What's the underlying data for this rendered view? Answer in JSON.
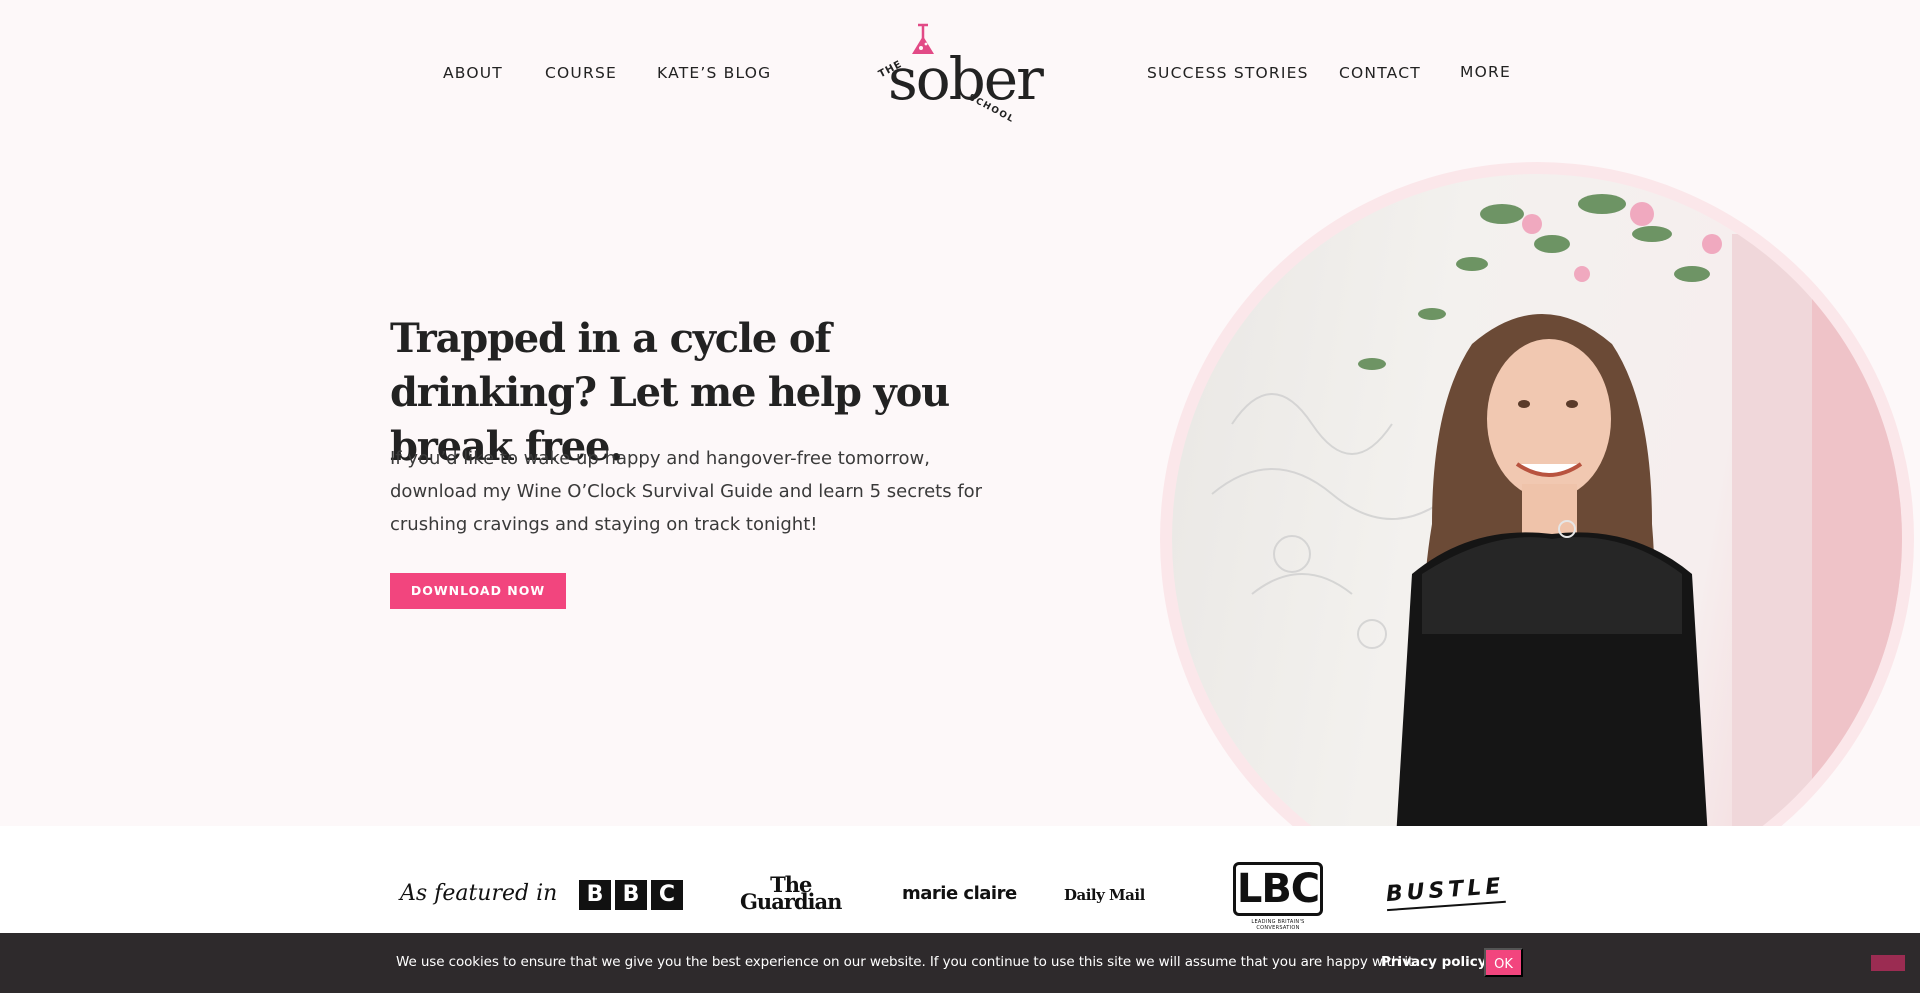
{
  "nav": {
    "left": [
      {
        "label": "ABOUT"
      },
      {
        "label": "COURSE"
      },
      {
        "label": "KATE’S BLOG"
      }
    ],
    "right": [
      {
        "label": "SUCCESS STORIES"
      },
      {
        "label": "CONTACT"
      },
      {
        "label": "MORE"
      }
    ]
  },
  "logo": {
    "the": "THE",
    "sober": "sober",
    "school": "SCHOOL"
  },
  "hero": {
    "title": "Trapped in a cycle of drinking? Let me help you break free.",
    "body": "If you’d like to wake up happy and hangover-free tomorrow, download my Wine O’Clock Survival Guide and learn 5 secrets for crushing cravings and staying on track tonight!",
    "cta_label": "DOWNLOAD NOW"
  },
  "featured": {
    "label": "As featured in",
    "logos": {
      "bbc": [
        "B",
        "B",
        "C"
      ],
      "guardian_line1": "The",
      "guardian_line2": "Guardian",
      "marie_claire": "marie claire",
      "daily_mail": "Daily Mail",
      "lbc": "LBC",
      "lbc_tagline": "LEADING BRITAIN'S CONVERSATION",
      "bustle": "BUSTLE"
    }
  },
  "cookie": {
    "text": "We use cookies to ensure that we give you the best experience on our website. If you continue to use this site we will assume that you are happy with it.",
    "privacy_label": "Privacy policy",
    "ok_label": "OK"
  },
  "colors": {
    "accent": "#f2457e",
    "page_bg": "#fdf8f9",
    "cookie_bg": "#2e2a2c"
  }
}
